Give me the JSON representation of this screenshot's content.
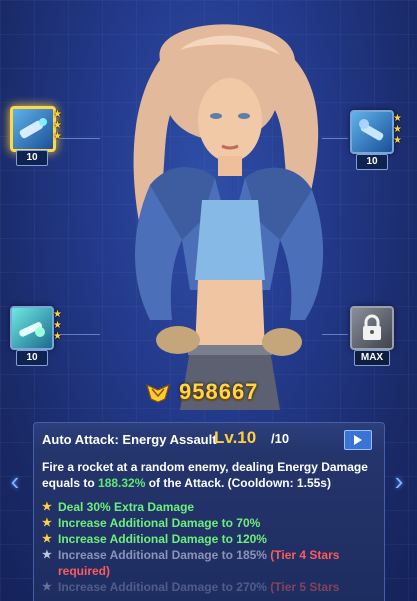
{
  "skills": [
    {
      "level": "10",
      "stars": 3,
      "icon": "rocket-launcher-icon",
      "selected": true
    },
    {
      "level": "10",
      "stars": 3,
      "icon": "ice-cannon-icon",
      "selected": false
    },
    {
      "level": "10",
      "stars": 3,
      "icon": "energy-blast-icon",
      "selected": false
    },
    {
      "level": "MAX",
      "stars": 0,
      "icon": "padlock-icon",
      "selected": false
    }
  ],
  "power": {
    "value": "958667"
  },
  "skill_detail": {
    "name": "Auto Attack: Energy Assault",
    "level_prefix": "Lv.10",
    "level_max": "/10",
    "desc_part1": "Fire a rocket at a random enemy, dealing Energy Damage equals to ",
    "desc_highlight": "188.32%",
    "desc_part2": " of the Attack. (Cooldown: 1.55s)",
    "effects": [
      {
        "text": "Deal 30% Extra Damage",
        "req": "",
        "unlocked": true
      },
      {
        "text": "Increase Additional Damage to 70%",
        "req": "",
        "unlocked": true
      },
      {
        "text": "Increase Additional Damage to 120%",
        "req": "",
        "unlocked": true
      },
      {
        "text": "Increase Additional Damage to 185% ",
        "req": "(Tier 4 Stars required)",
        "unlocked": false
      },
      {
        "text": "Increase Additional Damage to 270% ",
        "req": "(Tier 5 Stars",
        "unlocked": false
      }
    ]
  },
  "nav": {
    "left": "‹",
    "right": "›"
  },
  "colors": {
    "accent_gold": "#ffd54a",
    "unlocked_green": "#6df07a",
    "locked_gray": "#8d93b8",
    "requirement_red": "#ff5a5a"
  }
}
